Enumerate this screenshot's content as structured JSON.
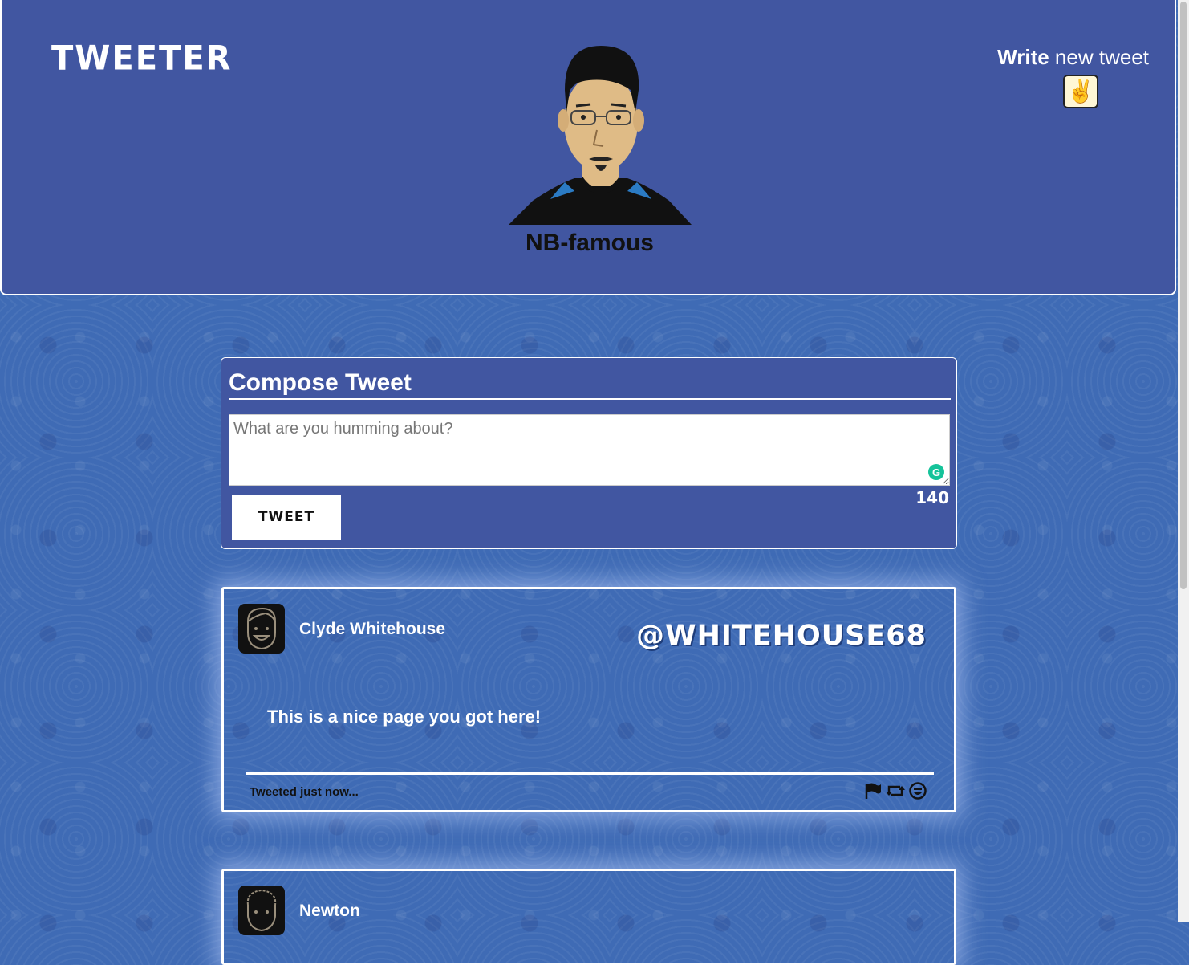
{
  "header": {
    "logo": "TWEETER",
    "profile_name": "NB-famous",
    "write_bold": "Write",
    "write_rest": " new tweet",
    "write_icon": "✌"
  },
  "compose": {
    "title": "Compose Tweet",
    "placeholder": "What are you humming about?",
    "button_label": "TWEET",
    "counter": "140",
    "grammarly_glyph": "G"
  },
  "tweets": [
    {
      "name": "Clyde Whitehouse",
      "handle": "@WHITEHOUSE68",
      "text": "This is a nice page you got here!",
      "time": "Tweeted just now...",
      "actions": [
        "flag-icon",
        "retweet-icon",
        "like-icon"
      ]
    },
    {
      "name": "Newton"
    }
  ],
  "colors": {
    "header_bg": "#4156a1",
    "page_bg": "#3f6bb5",
    "text_light": "#ffffff",
    "text_dark": "#111111"
  }
}
